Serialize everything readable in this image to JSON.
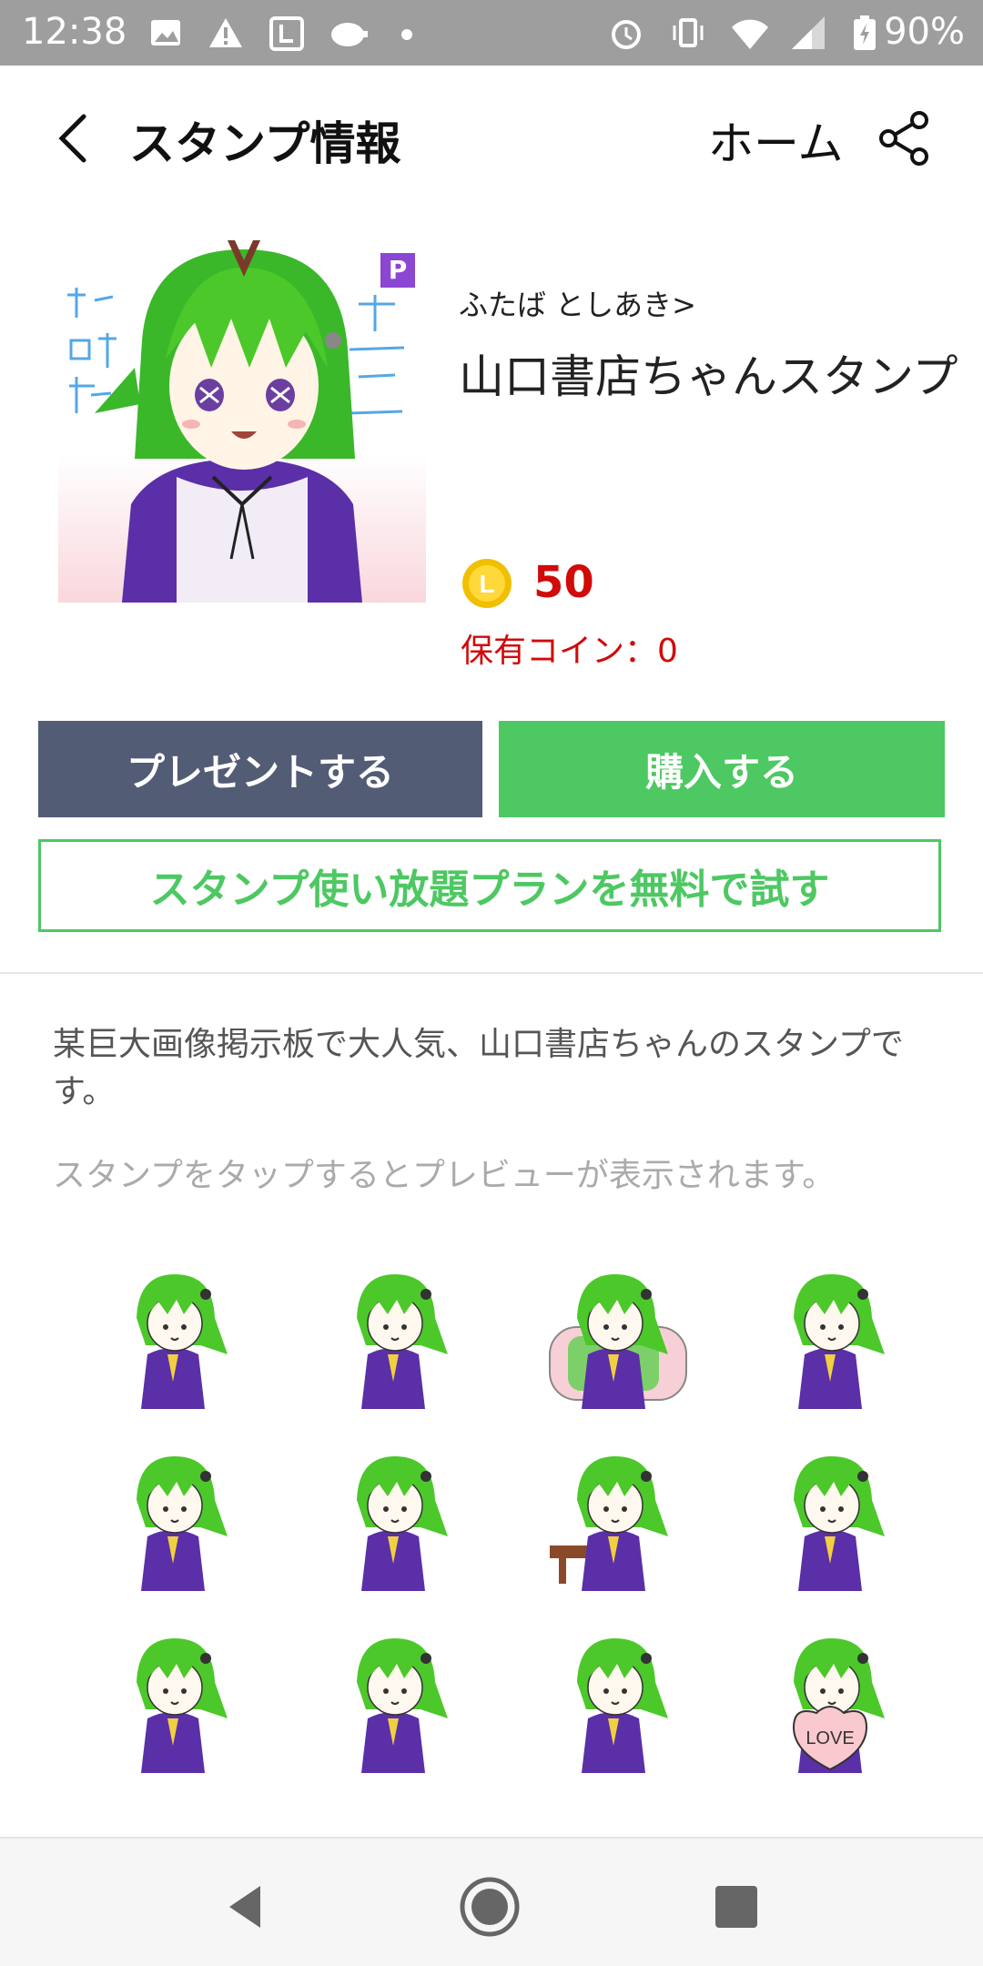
{
  "status_bar": {
    "time": "12:38",
    "battery": "90%",
    "icons": [
      "image-icon",
      "warning-icon",
      "line-icon",
      "piggy-icon",
      "dot-icon",
      "alarm-icon",
      "vibrate-icon",
      "wifi-icon",
      "signal-icon",
      "battery-icon"
    ]
  },
  "header": {
    "back_icon": "chevron-left-icon",
    "title": "スタンプ情報",
    "home_label": "ホーム",
    "share_icon": "share-icon"
  },
  "product": {
    "badge": "P",
    "author": "ふたば としあき>",
    "title": "山口書店ちゃんスタンプ",
    "price": "50",
    "coin_label": "L",
    "owned": "保有コイン：0"
  },
  "buttons": {
    "present": "プレゼントする",
    "buy": "購入する",
    "trial": "スタンプ使い放題プランを無料で試す"
  },
  "description": "某巨大画像掲示板で大人気、山口書店ちゃんのスタンプです。",
  "hint": "スタンプをタップするとプレビューが表示されます。",
  "stickers": [
    {
      "name": "sticker-greeting"
    },
    {
      "name": "sticker-angry"
    },
    {
      "name": "sticker-sleeping"
    },
    {
      "name": "sticker-reading"
    },
    {
      "name": "sticker-praying"
    },
    {
      "name": "sticker-cheering"
    },
    {
      "name": "sticker-eating"
    },
    {
      "name": "sticker-dizzy"
    },
    {
      "name": "sticker-drinking"
    },
    {
      "name": "sticker-collapsed"
    },
    {
      "name": "sticker-thinking"
    },
    {
      "name": "sticker-love"
    }
  ],
  "sticker_text": "LOVE",
  "colors": {
    "accent_green": "#4dc862",
    "present_gray": "#525c75",
    "price_red": "#d10a0a",
    "hair_green": "#4cc82a",
    "dress_purple": "#5b2fa8"
  },
  "nav": {
    "back": "nav-back-icon",
    "home": "nav-home-icon",
    "recents": "nav-recents-icon"
  }
}
